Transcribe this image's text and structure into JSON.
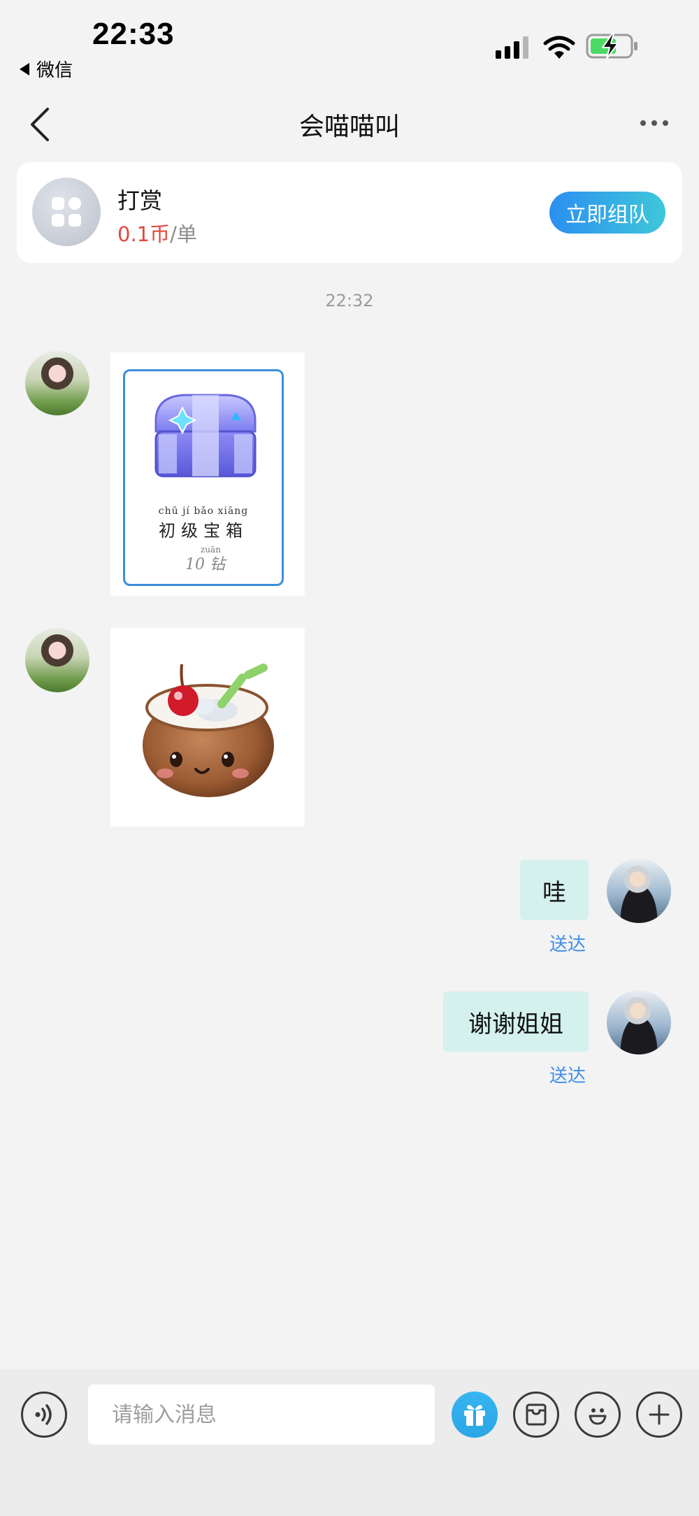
{
  "status_bar": {
    "time": "22:33",
    "back_app": "微信"
  },
  "nav": {
    "title": "会喵喵叫"
  },
  "service": {
    "name": "打赏",
    "price": "0.1币",
    "unit": "/单",
    "button": "立即组队"
  },
  "chat": {
    "timestamp": "22:32",
    "gift_card": {
      "pinyin": "chū jí bǎo xiāng",
      "label": "初级宝箱",
      "price_pinyin": "zuān",
      "price": "10 钻"
    },
    "messages": [
      {
        "text": "哇",
        "status": "送达"
      },
      {
        "text": "谢谢姐姐",
        "status": "送达"
      }
    ]
  },
  "input": {
    "placeholder": "请输入消息",
    "value": ""
  },
  "colors": {
    "accent_blue": "#3f8fe6",
    "price_red": "#e1483f",
    "bubble_bg": "#d4f1ed",
    "gift_button": "#2aa6e4"
  },
  "icons": [
    "signal-icon",
    "wifi-icon",
    "battery-charging-icon",
    "back-arrow-icon",
    "more-icon",
    "grid-icon",
    "voice-icon",
    "gift-icon",
    "coupon-icon",
    "emoji-icon",
    "plus-icon"
  ]
}
